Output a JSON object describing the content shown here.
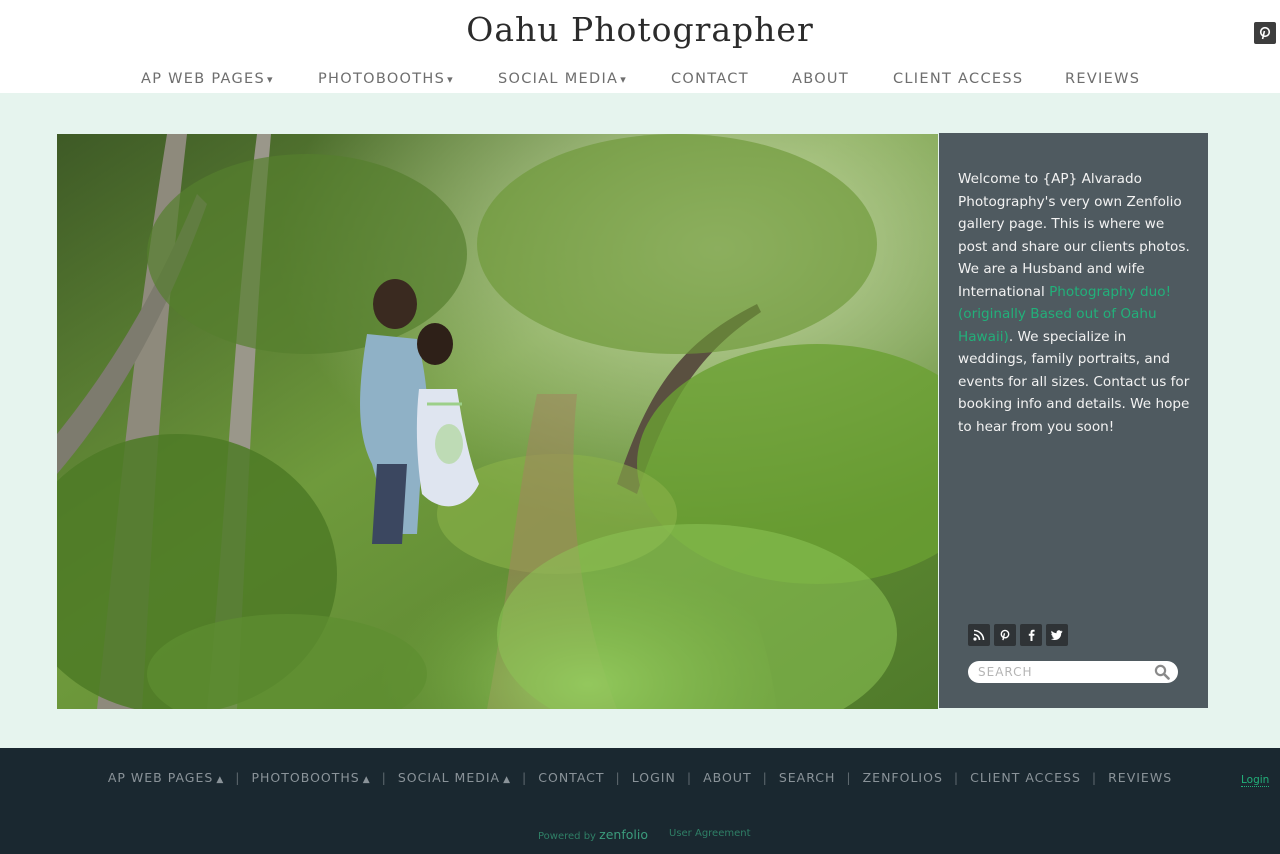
{
  "header": {
    "site_title": "Oahu Photographer",
    "nav": [
      {
        "label": "AP WEB PAGES",
        "caret": "▾"
      },
      {
        "label": "PHOTOBOOTHS",
        "caret": "▾"
      },
      {
        "label": "SOCIAL MEDIA",
        "caret": "▾"
      },
      {
        "label": "CONTACT"
      },
      {
        "label": "ABOUT"
      },
      {
        "label": "CLIENT ACCESS"
      },
      {
        "label": "REVIEWS"
      }
    ],
    "pinterest_icon": "pinterest-icon"
  },
  "panel": {
    "intro_before": "Welcome to {AP} Alvarado Photography's very own Zenfolio gallery page. This is where we post and share our clients photos. We are a Husband and wife International ",
    "intro_link": "Photography duo! (originally Based out of Oahu Hawaii)",
    "intro_after": ". We specialize in weddings, family portraits, and events for all sizes.  Contact us for booking info and details. We hope to hear from you soon!",
    "social_icons": [
      "rss-icon",
      "pinterest-icon",
      "facebook-icon",
      "twitter-icon"
    ],
    "search_placeholder": "SEARCH"
  },
  "footer": {
    "nav": [
      {
        "label": "AP WEB PAGES",
        "arrow": "▲"
      },
      {
        "label": "PHOTOBOOTHS",
        "arrow": "▲"
      },
      {
        "label": "SOCIAL MEDIA",
        "arrow": "▲"
      },
      {
        "label": "CONTACT"
      },
      {
        "label": "LOGIN"
      },
      {
        "label": "ABOUT"
      },
      {
        "label": "SEARCH"
      },
      {
        "label": "ZENFOLIOS"
      },
      {
        "label": "CLIENT ACCESS"
      },
      {
        "label": "REVIEWS"
      }
    ],
    "login_label": "Login",
    "powered_by": "Powered by",
    "brand": "zenfolio",
    "user_agreement": "User Agreement"
  },
  "colors": {
    "page_bg": "#e6f4ee",
    "panel_bg": "#4f5a60",
    "accent": "#22b07a",
    "footer_bg": "#1a2830"
  }
}
